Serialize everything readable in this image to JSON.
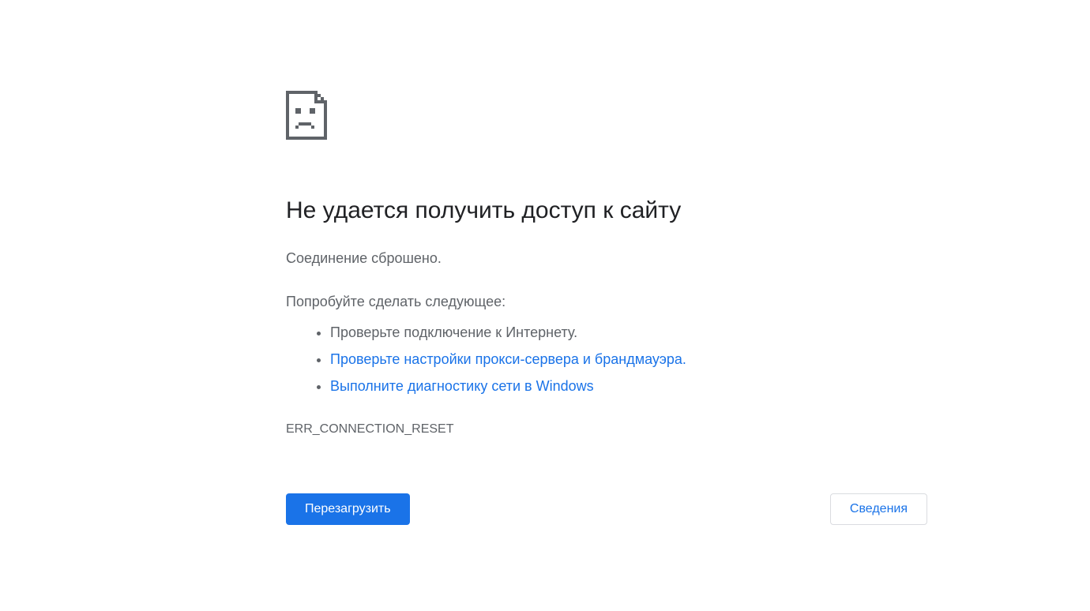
{
  "error": {
    "title": "Не удается получить доступ к сайту",
    "message": "Соединение сброшено.",
    "try_heading": "Попробуйте сделать следующее:",
    "suggestions": [
      {
        "text": "Проверьте подключение к Интернету.",
        "link": false
      },
      {
        "text": "Проверьте настройки прокси-сервера и брандмауэра.",
        "link": true
      },
      {
        "text": "Выполните диагностику сети в Windows",
        "link": true
      }
    ],
    "code": "ERR_CONNECTION_RESET"
  },
  "buttons": {
    "reload": "Перезагрузить",
    "details": "Сведения"
  }
}
